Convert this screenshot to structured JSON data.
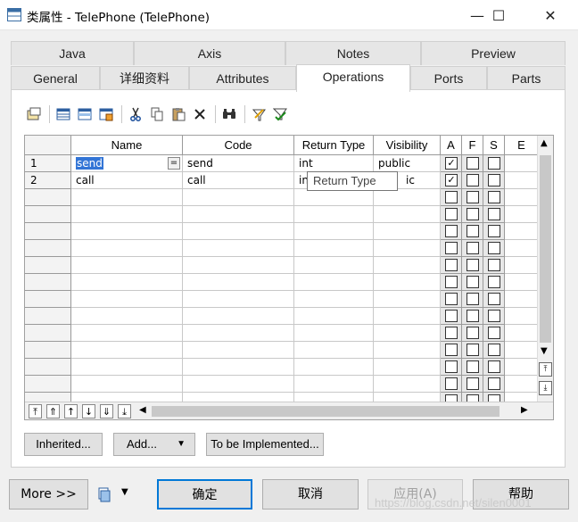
{
  "window": {
    "title": "类属性 - TelePhone (TelePhone)",
    "minimize": "—",
    "maximize": "☐",
    "close": "✕"
  },
  "tabs": {
    "row1": [
      "Java",
      "Axis",
      "Notes",
      "Preview"
    ],
    "row2": [
      "General",
      "详细资料",
      "Attributes",
      "Operations",
      "Ports",
      "Parts"
    ],
    "active": "Operations"
  },
  "toolbar": {
    "icons": [
      "properties-icon",
      "add-row-icon",
      "insert-row-icon",
      "add-objects-icon",
      "cut-icon",
      "copy-icon",
      "paste-icon",
      "delete-icon",
      "find-icon",
      "customize-columns-icon",
      "filter-icon"
    ]
  },
  "grid": {
    "columns": [
      "Name",
      "Code",
      "Return Type",
      "Visibility",
      "A",
      "F",
      "S",
      "E"
    ],
    "rows": [
      {
        "num": "1",
        "name": "send",
        "code": "send",
        "return_type": "int",
        "visibility": "public",
        "a": true,
        "f": false,
        "s": false
      },
      {
        "num": "2",
        "name": "call",
        "code": "call",
        "return_type": "in",
        "visibility": "ic",
        "a": true,
        "f": false,
        "s": false
      }
    ],
    "tooltip": "Return Type",
    "edit_button": "="
  },
  "panel_buttons": {
    "inherited": "Inherited...",
    "add": "Add...",
    "to_be_implemented": "To be Implemented..."
  },
  "bottom_buttons": {
    "more": "More >>",
    "ok": "确定",
    "cancel": "取消",
    "apply": "应用(A)",
    "help": "帮助"
  },
  "watermark": "https://blog.csdn.net/silen0001"
}
